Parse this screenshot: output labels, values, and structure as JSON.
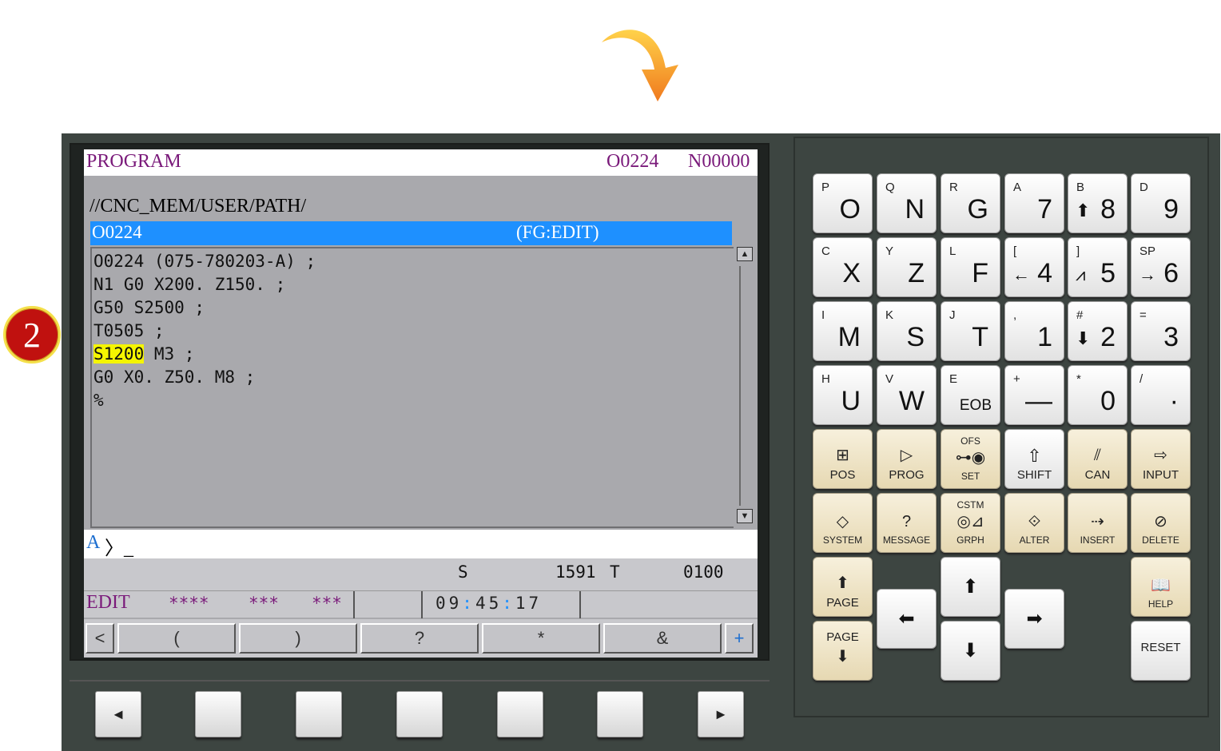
{
  "screen": {
    "title": "PROGRAM",
    "program_number": "O0224",
    "sequence_number": "N00000",
    "path": "//CNC_MEM/USER/PATH/",
    "program_bar": {
      "name": "O0224",
      "mode": "(FG:EDIT)"
    },
    "program_lines": [
      {
        "text": "O0224 (075-780203-A) ;"
      },
      {
        "text": "N1 G0 X200. Z150. ;"
      },
      {
        "text": "G50 S2500 ;"
      },
      {
        "text": "T0505 ;"
      },
      {
        "highlight": "S1200",
        "rest": " M3 ;"
      },
      {
        "text": "G0 X0. Z50. M8 ;"
      },
      {
        "text": "%"
      }
    ],
    "input_prefix": "A",
    "input_prompt": "〉_",
    "status": {
      "s_label": "S",
      "s_value": "1591",
      "t_label": "T",
      "t_value": "0100"
    },
    "mode_line": {
      "mode": "EDIT",
      "stars1": "****",
      "stars2": "***",
      "stars3": "***",
      "clock_h": "09",
      "clock_m": "45",
      "clock_s": "17",
      "colon": ":"
    },
    "softkeys": [
      "<",
      "(",
      ")",
      "?",
      "*",
      "&",
      "+"
    ]
  },
  "badge": "2",
  "lower_keys": {
    "left": "◄",
    "right": "►"
  },
  "keypad": {
    "row1": [
      {
        "sm": "P",
        "bg": "O"
      },
      {
        "sm": "Q",
        "bg": "N"
      },
      {
        "sm": "R",
        "bg": "G"
      },
      {
        "sm": "A",
        "bg": "7"
      },
      {
        "sm": "B",
        "pre": "⬆",
        "bg": "8"
      },
      {
        "sm": "D",
        "bg": "9"
      }
    ],
    "row2": [
      {
        "sm": "C",
        "bg": "X"
      },
      {
        "sm": "Y",
        "bg": "Z"
      },
      {
        "sm": "L",
        "bg": "F"
      },
      {
        "sm": "[",
        "pre": "←",
        "bg": "4"
      },
      {
        "sm": "]",
        "pre": "⩘",
        "bg": "5"
      },
      {
        "sm": "SP",
        "pre": "→",
        "bg": "6"
      }
    ],
    "row3": [
      {
        "sm": "I",
        "bg": "M"
      },
      {
        "sm": "K",
        "bg": "S"
      },
      {
        "sm": "J",
        "bg": "T"
      },
      {
        "sm": ",",
        "bg": "1"
      },
      {
        "sm": "#",
        "pre": "⬇",
        "bg": "2"
      },
      {
        "sm": "=",
        "bg": "3"
      }
    ],
    "row4": [
      {
        "sm": "H",
        "bg": "U"
      },
      {
        "sm": "V",
        "bg": "W"
      },
      {
        "sm": "E",
        "md": "EOB"
      },
      {
        "sm": "+",
        "bg": "—"
      },
      {
        "sm": "*",
        "bg": "0"
      },
      {
        "sm": "/",
        "bg": "·"
      }
    ],
    "func_row1": {
      "pos": "POS",
      "prog": "PROG",
      "ofs": "OFS",
      "set": "SET",
      "shift": "SHIFT",
      "can": "CAN",
      "input": "INPUT"
    },
    "func_row2": {
      "system": "SYSTEM",
      "message": "MESSAGE",
      "csttm": "CSTM",
      "grph": "GRPH",
      "alter": "ALTER",
      "insert": "INSERT",
      "delete": "DELETE"
    },
    "page_up": "PAGE",
    "page_down": "PAGE",
    "help": "HELP",
    "reset": "RESET"
  },
  "colors": {
    "accent": "#1e90ff",
    "title": "#7a1a7a",
    "highlight": "#f5f500",
    "badge": "#c0110f"
  }
}
